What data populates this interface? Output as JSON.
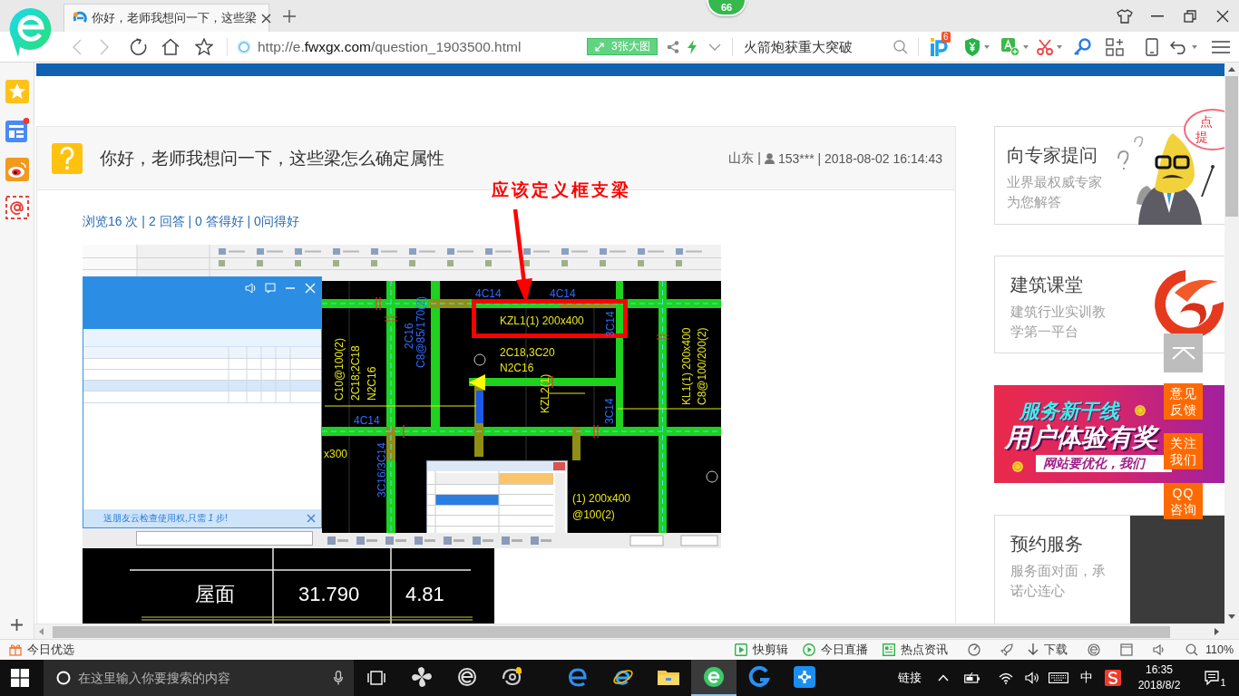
{
  "browser": {
    "badge": "66",
    "tab": {
      "title": "你好，老师我想问一下，这些梁"
    },
    "url": "http://e.**fwxgx.com**/question_1903500.html",
    "big_image_button": "3张大图",
    "search_placeholder": "火箭炮获重大突破",
    "extension_badge": "6"
  },
  "question": {
    "title": "你好，老师我想问一下，这些梁怎么确定属性",
    "region": "山东 |",
    "author_and_date": "153*** | 2018-08-02 16:14:43",
    "stats": "浏览16 次 | 2 回答 | 0 答得好 | 0问得好",
    "annotation": "应该定义框支梁",
    "cad_labels": [
      {
        "text": "4C14",
        "color": "#2f6bff"
      },
      {
        "text": "4C14",
        "color": "#2f6bff"
      },
      {
        "text": "4C14",
        "color": "#2f6bff"
      },
      {
        "text": "KZL1(1) 200x400",
        "color": "#e6e619"
      },
      {
        "text": "2C18,3C20",
        "color": "#e6e619"
      },
      {
        "text": "N2C16",
        "color": "#e6e619"
      },
      {
        "text": "C10@100(2)",
        "color": "#e6e619"
      },
      {
        "text": "2C18;2C18",
        "color": "#e6e619"
      },
      {
        "text": "N2C16",
        "color": "#e6e619"
      },
      {
        "text": "2C16",
        "color": "#2f6bff"
      },
      {
        "text": "C8@85/170(2)",
        "color": "#2f6bff"
      },
      {
        "text": "KZL2(1)",
        "color": "#e6e619"
      },
      {
        "text": "3C14",
        "color": "#2f6bff"
      },
      {
        "text": "3C14",
        "color": "#2f6bff"
      },
      {
        "text": "KL1(1) 200x400",
        "color": "#e6e619"
      },
      {
        "text": "C8@100/200(2)",
        "color": "#e6e619"
      },
      {
        "text": "3C16/3C14",
        "color": "#2f6bff"
      },
      {
        "text": "x300",
        "color": "#e6e619"
      },
      {
        "text": "(1) 200x400",
        "color": "#e6e619"
      },
      {
        "text": "@100(2)",
        "color": "#e6e619"
      }
    ],
    "dialog_promo": "送朋友云检查使用权,只需 *1* 步!",
    "table_labels": [
      "屋面",
      "31.790",
      "4.81"
    ]
  },
  "right_column": [
    {
      "kind": "card",
      "title": "向专家提问",
      "subtitle": "业界最权威专家为您解答",
      "callout_lines": [
        "点",
        "提"
      ]
    },
    {
      "kind": "card",
      "title": "建筑课堂",
      "subtitle": "建筑行业实训教学第一平台"
    },
    {
      "kind": "banner",
      "headline": "服务新干线",
      "title": "用户体验有奖",
      "tagline": "网站要优化，我们"
    },
    {
      "kind": "card",
      "title": "预约服务",
      "subtitle": "服务面对面，承诺心连心"
    }
  ],
  "float_buttons": [
    "意见反馈",
    "关注我们",
    "QQ咨询"
  ],
  "status_bar": {
    "left": "今日优选",
    "items": [
      "快剪辑",
      "今日直播",
      "热点资讯",
      "下载"
    ],
    "zoom": "110%"
  },
  "taskbar": {
    "search_placeholder": "在这里输入你要搜索的内容",
    "apps": [
      {
        "selected": false
      },
      {
        "selected": false
      },
      {
        "selected": false
      },
      {
        "selected": false
      },
      {
        "selected": false
      },
      {
        "selected": false
      },
      {
        "selected": true
      },
      {
        "selected": false
      },
      {
        "selected": false
      }
    ],
    "links": "链接",
    "ime": "中",
    "time": "16:35",
    "date": "2018/8/2",
    "notifications": "1"
  }
}
